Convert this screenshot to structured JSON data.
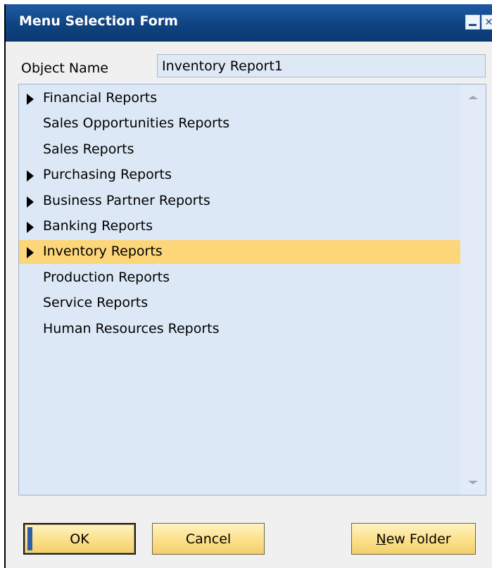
{
  "window": {
    "title": "Menu Selection Form"
  },
  "form": {
    "object_name_label": "Object Name",
    "object_name_value": "Inventory Report1"
  },
  "list": {
    "items": [
      {
        "label": "Financial Reports",
        "expandable": true,
        "selected": false
      },
      {
        "label": "Sales Opportunities Reports",
        "expandable": false,
        "selected": false
      },
      {
        "label": "Sales Reports",
        "expandable": false,
        "selected": false
      },
      {
        "label": "Purchasing Reports",
        "expandable": true,
        "selected": false
      },
      {
        "label": "Business Partner Reports",
        "expandable": true,
        "selected": false
      },
      {
        "label": "Banking Reports",
        "expandable": true,
        "selected": false
      },
      {
        "label": "Inventory Reports",
        "expandable": true,
        "selected": true
      },
      {
        "label": "Production Reports",
        "expandable": false,
        "selected": false
      },
      {
        "label": "Service Reports",
        "expandable": false,
        "selected": false
      },
      {
        "label": "Human Resources Reports",
        "expandable": false,
        "selected": false
      }
    ]
  },
  "buttons": {
    "ok": "OK",
    "cancel": "Cancel",
    "new_folder": "New Folder"
  },
  "colors": {
    "titlebar": "#0e427f",
    "list_background": "#dde8f6",
    "selected_row": "#fcd679",
    "button_face": "#fbe08a"
  },
  "icons": {
    "expand": "triangle-right-icon",
    "minimize": "minimize-icon",
    "close": "close-icon",
    "scroll_up": "scroll-up-icon",
    "scroll_down": "scroll-down-icon"
  }
}
